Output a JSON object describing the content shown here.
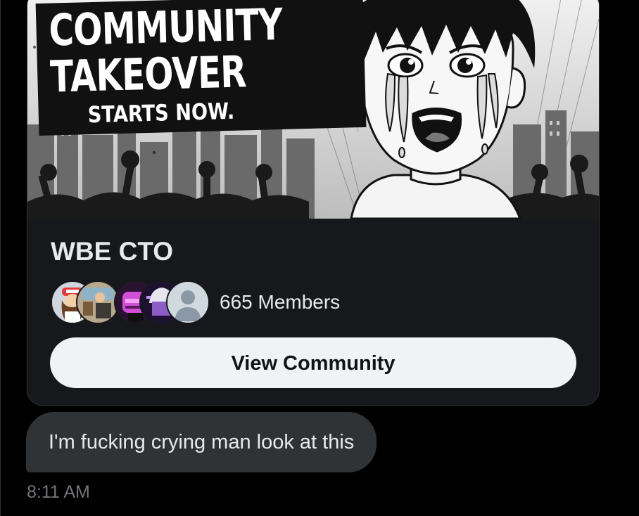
{
  "card": {
    "banner": {
      "headline_line1": "COMMUNITY",
      "headline_line2": "TAKEOVER",
      "headline_line3": "STARTS NOW.",
      "style": "black-and-white manga illustration"
    },
    "name": "WBE CTO",
    "members_label": "665 Members",
    "avatar_icons": [
      "avatar-cartoon-girl-icon",
      "avatar-pixel-room-icon",
      "avatar-pink-robot-icon",
      "avatar-glitch-purple-icon",
      "avatar-default-person-icon"
    ],
    "button_label": "View Community"
  },
  "message": {
    "text": "I'm fucking crying man look at this",
    "time": "8:11 AM"
  },
  "colors": {
    "background": "#000000",
    "card_bg": "#16181c",
    "bubble_bg": "#2f3336",
    "button_bg": "#eff3f4",
    "text_primary": "#e7e9ea",
    "text_secondary": "#71767b"
  }
}
